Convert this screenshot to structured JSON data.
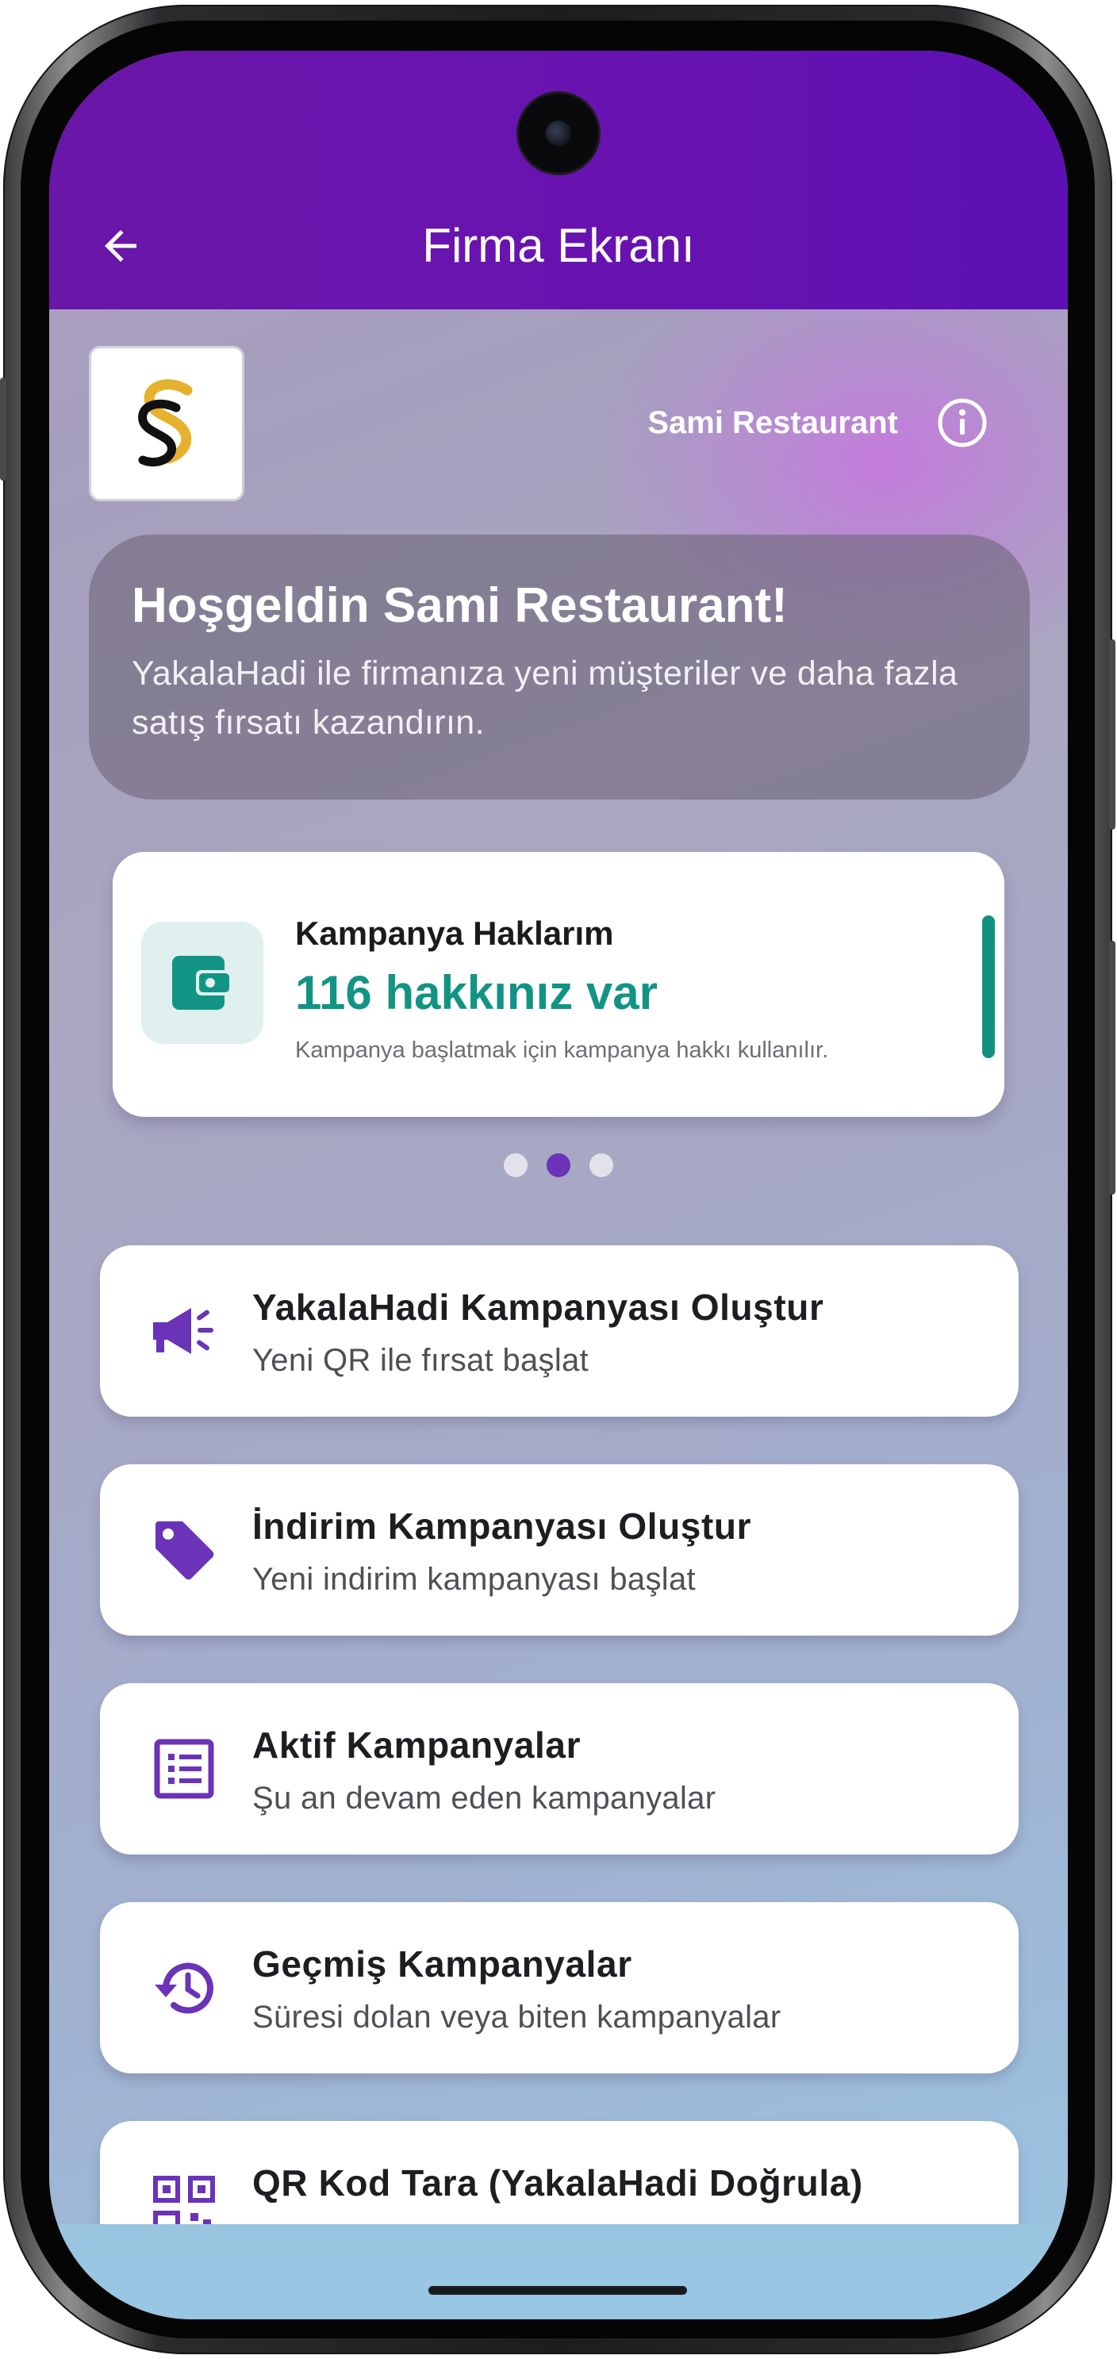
{
  "appbar": {
    "title": "Firma Ekranı"
  },
  "header": {
    "company_name": "Sami Restaurant"
  },
  "welcome": {
    "title": "Hoşgeldin Sami Restaurant!",
    "text": "YakalaHadi ile firmanıza yeni müşteriler ve daha fazla satış fırsatı kazandırın."
  },
  "rights_card": {
    "title": "Kampanya Haklarım",
    "count": "116 hakkınız var",
    "note": "Kampanya başlatmak için kampanya hakkı kullanılır.",
    "icon": "wallet-icon"
  },
  "carousel": {
    "pages": 3,
    "active_index": 1
  },
  "menu": [
    {
      "title": "YakalaHadi Kampanyası Oluştur",
      "subtitle": "Yeni QR ile fırsat başlat",
      "icon": "megaphone-icon"
    },
    {
      "title": "İndirim Kampanyası Oluştur",
      "subtitle": "Yeni indirim kampanyası başlat",
      "icon": "tag-icon"
    },
    {
      "title": "Aktif Kampanyalar",
      "subtitle": "Şu an devam eden kampanyalar",
      "icon": "list-icon"
    },
    {
      "title": "Geçmiş Kampanyalar",
      "subtitle": "Süresi dolan veya biten kampanyalar",
      "icon": "history-icon"
    },
    {
      "title": "QR Kod Tara (YakalaHadi Doğrula)",
      "subtitle": "",
      "icon": "qr-code-icon"
    }
  ],
  "colors": {
    "primary": "#6A16A8",
    "accent_teal": "#129485",
    "icon_purple": "#6A33B8",
    "text_dark": "#1E1E22"
  }
}
